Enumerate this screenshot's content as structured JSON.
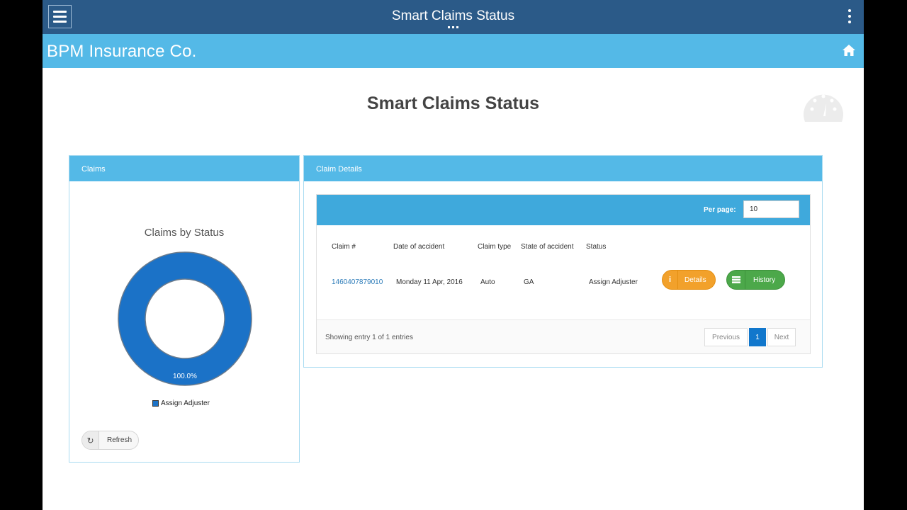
{
  "appbar": {
    "title": "Smart Claims Status"
  },
  "brand": {
    "name": "BPM Insurance Co."
  },
  "page": {
    "title": "Smart Claims Status"
  },
  "claims_panel": {
    "header": "Claims",
    "chart_title": "Claims by Status",
    "refresh_label": "Refresh"
  },
  "chart_data": {
    "type": "pie",
    "title": "Claims by Status",
    "categories": [
      "Assign Adjuster"
    ],
    "values": [
      100.0
    ],
    "value_labels": [
      "100.0%"
    ],
    "colors": [
      "#1b72c7"
    ],
    "legend_placement": "bottom"
  },
  "details_panel": {
    "header": "Claim Details",
    "per_page_label": "Per page:",
    "per_page_value": "10",
    "columns": [
      "Claim #",
      "Date of accident",
      "Claim type",
      "State of accident",
      "Status"
    ],
    "rows": [
      {
        "claim_number": "1460407879010",
        "date": "Monday 11 Apr, 2016",
        "type": "Auto",
        "state": "GA",
        "status": "Assign Adjuster",
        "details_label": "Details",
        "history_label": "History"
      }
    ],
    "showing_text": "Showing entry 1 of 1 entries",
    "pager": {
      "previous": "Previous",
      "current": "1",
      "next": "Next"
    }
  },
  "colors": {
    "appbar": "#2b5a88",
    "brandbar": "#54b9e7",
    "details_button": "#f2a12b",
    "history_button": "#4ca84a",
    "active_page": "#1177cc"
  }
}
